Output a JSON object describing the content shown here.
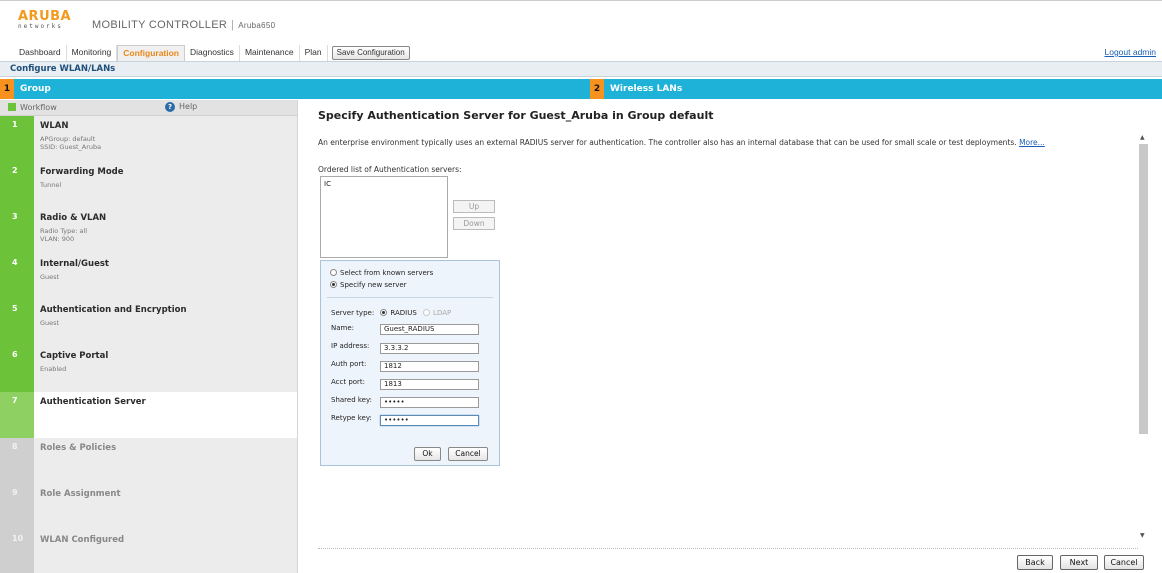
{
  "brand": {
    "logo": "ARUBA",
    "logo_sub": "networks",
    "product": "MOBILITY CONTROLLER",
    "separator": "|",
    "host": "Aruba650"
  },
  "tabs": [
    {
      "label": "Dashboard"
    },
    {
      "label": "Monitoring"
    },
    {
      "label": "Configuration",
      "active": true
    },
    {
      "label": "Diagnostics"
    },
    {
      "label": "Maintenance"
    },
    {
      "label": "Plan"
    }
  ],
  "save_button": "Save Configuration",
  "logout": "Logout admin",
  "breadcrumb": "Configure WLAN/LANs",
  "steps_header": [
    {
      "num": "1",
      "label": "Group"
    },
    {
      "num": "2",
      "label": "Wireless LANs"
    }
  ],
  "sidebar": {
    "workflow": "Workflow",
    "help": "Help",
    "steps": [
      {
        "num": "1",
        "title": "WLAN",
        "sub1": "APGroup: default",
        "sub2": "SSID: Guest_Aruba",
        "state": "done"
      },
      {
        "num": "2",
        "title": "Forwarding Mode",
        "sub1": "Tunnel",
        "sub2": "",
        "state": "done"
      },
      {
        "num": "3",
        "title": "Radio & VLAN",
        "sub1": "Radio Type: all",
        "sub2": "VLAN: 900",
        "state": "done"
      },
      {
        "num": "4",
        "title": "Internal/Guest",
        "sub1": "Guest",
        "sub2": "",
        "state": "done"
      },
      {
        "num": "5",
        "title": "Authentication and Encryption",
        "sub1": "Guest",
        "sub2": "",
        "state": "done"
      },
      {
        "num": "6",
        "title": "Captive Portal",
        "sub1": "Enabled",
        "sub2": "",
        "state": "done"
      },
      {
        "num": "7",
        "title": "Authentication Server",
        "sub1": "",
        "sub2": "",
        "state": "current"
      },
      {
        "num": "8",
        "title": "Roles & Policies",
        "sub1": "",
        "sub2": "",
        "state": "future"
      },
      {
        "num": "9",
        "title": "Role Assignment",
        "sub1": "",
        "sub2": "",
        "state": "future"
      },
      {
        "num": "10",
        "title": "WLAN Configured",
        "sub1": "",
        "sub2": "",
        "state": "future"
      }
    ]
  },
  "main": {
    "title": "Specify Authentication Server for Guest_Aruba in Group default",
    "description": "An enterprise environment typically uses an external RADIUS server for authentication. The controller also has an internal database that can be used for small scale or test deployments.",
    "more_link": "More...",
    "list_label": "Ordered list of Authentication servers:",
    "list_items": [
      "IC"
    ],
    "up_button": "Up",
    "down_button": "Down"
  },
  "dialog": {
    "radio_known": "Select from known servers",
    "radio_new": "Specify new server",
    "server_type_label": "Server type:",
    "radius_label": "RADIUS",
    "ldap_label": "LDAP",
    "name_label": "Name:",
    "name_value": "Guest_RADIUS",
    "ip_label": "IP address:",
    "ip_value": "3.3.3.2",
    "auth_port_label": "Auth port:",
    "auth_port_value": "1812",
    "acct_port_label": "Acct port:",
    "acct_port_value": "1813",
    "shared_key_label": "Shared key:",
    "shared_key_value": "•••••",
    "retype_key_label": "Retype key:",
    "retype_key_value": "••••••",
    "ok": "Ok",
    "cancel": "Cancel"
  },
  "nav": {
    "back": "Back",
    "next": "Next",
    "cancel": "Cancel"
  },
  "colors": {
    "accent_orange": "#f7921e",
    "step_blue": "#1fb2d8",
    "done_green": "#6cc33a"
  }
}
